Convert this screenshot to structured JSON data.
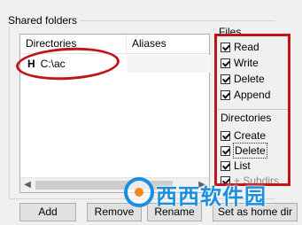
{
  "shared_folders": {
    "title": "Shared folders",
    "columns": {
      "directories": "Directories",
      "aliases": "Aliases"
    },
    "rows": [
      {
        "marker": "H",
        "path": "C:\\ac",
        "alias": ""
      }
    ]
  },
  "files": {
    "title": "Files",
    "items": [
      {
        "label": "Read",
        "checked": true
      },
      {
        "label": "Write",
        "checked": true
      },
      {
        "label": "Delete",
        "checked": true
      },
      {
        "label": "Append",
        "checked": true
      }
    ]
  },
  "directories": {
    "title": "Directories",
    "items": [
      {
        "label": "Create",
        "checked": true
      },
      {
        "label": "Delete",
        "checked": true,
        "focused": true
      },
      {
        "label": "List",
        "checked": true
      },
      {
        "label": "+ Subdirs",
        "checked": true
      }
    ]
  },
  "buttons": {
    "add": "Add",
    "remove": "Remove",
    "rename": "Rename",
    "set_home": "Set as home dir"
  },
  "watermark": {
    "text": "西西软件园"
  },
  "colors": {
    "annotation": "#c0151b",
    "watermark_blue": "#1a8fe0"
  }
}
